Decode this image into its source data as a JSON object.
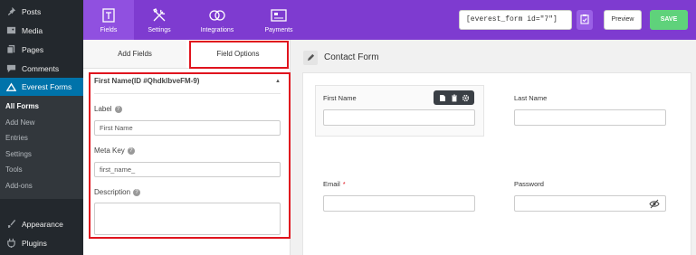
{
  "wp_sidebar": {
    "items": [
      {
        "label": "Posts",
        "icon": "pushpin-icon"
      },
      {
        "label": "Media",
        "icon": "media-icon"
      },
      {
        "label": "Pages",
        "icon": "pages-icon"
      },
      {
        "label": "Comments",
        "icon": "comments-icon"
      }
    ],
    "active": {
      "label": "Everest Forms",
      "icon": "everest-forms-icon"
    },
    "submenu": [
      "All Forms",
      "Add New",
      "Entries",
      "Settings",
      "Tools",
      "Add-ons"
    ],
    "bottom_items": [
      {
        "label": "Appearance",
        "icon": "paint-brush-icon"
      },
      {
        "label": "Plugins",
        "icon": "plugin-icon"
      }
    ]
  },
  "topbar": {
    "nav": [
      {
        "label": "Fields",
        "icon": "fields-icon"
      },
      {
        "label": "Settings",
        "icon": "wrench-screwdriver-icon"
      },
      {
        "label": "Integrations",
        "icon": "integrations-icon"
      },
      {
        "label": "Payments",
        "icon": "payments-icon"
      }
    ],
    "shortcode": "[everest_form id=\"7\"]",
    "preview_label": "Preview",
    "save_label": "SAVE"
  },
  "panel": {
    "tabs": [
      "Add Fields",
      "Field Options"
    ],
    "section_title": "First Name(ID #QhdklbveFM-9)",
    "label_label": "Label",
    "label_value": "First Name",
    "meta_key_label": "Meta Key",
    "meta_key_value": "first_name_",
    "description_label": "Description"
  },
  "builder": {
    "form_title": "Contact Form",
    "fields": {
      "first_name": "First Name",
      "last_name": "Last Name",
      "email": "Email",
      "email_required": "*",
      "password": "Password"
    }
  },
  "colors": {
    "accent_purple": "#7e3bd0",
    "save_green": "#5fd27b",
    "highlight_red": "#e0141e",
    "wp_active_blue": "#0073aa"
  }
}
